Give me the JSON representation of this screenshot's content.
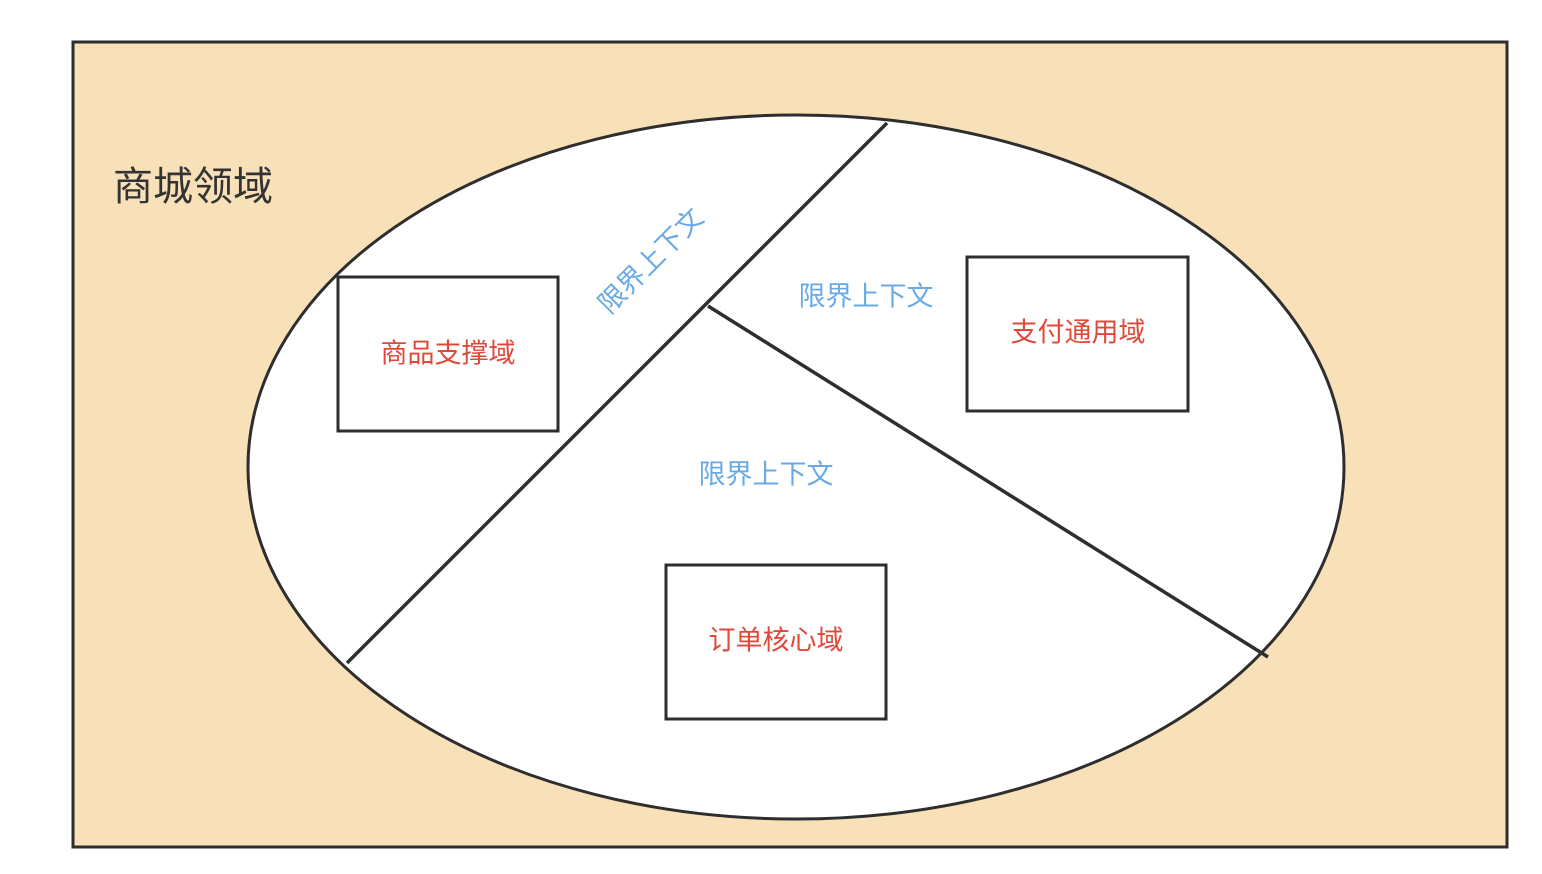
{
  "domain": {
    "title": "商城领域",
    "title_color": "#333333",
    "background_color": "#F8E0B8",
    "border_color": "#2E2E2E"
  },
  "ellipse": {
    "fill": "#FFFFFF",
    "stroke": "#2E2E2E"
  },
  "contexts": [
    {
      "label": "限界上下文",
      "color": "#6AAAE4"
    },
    {
      "label": "限界上下文",
      "color": "#6AAAE4"
    },
    {
      "label": "限界上下文",
      "color": "#6AAAE4"
    }
  ],
  "subdomains": [
    {
      "label": "商品支撑域",
      "color": "#E0483A"
    },
    {
      "label": "支付通用域",
      "color": "#E0483A"
    },
    {
      "label": "订单核心域",
      "color": "#E0483A"
    }
  ]
}
